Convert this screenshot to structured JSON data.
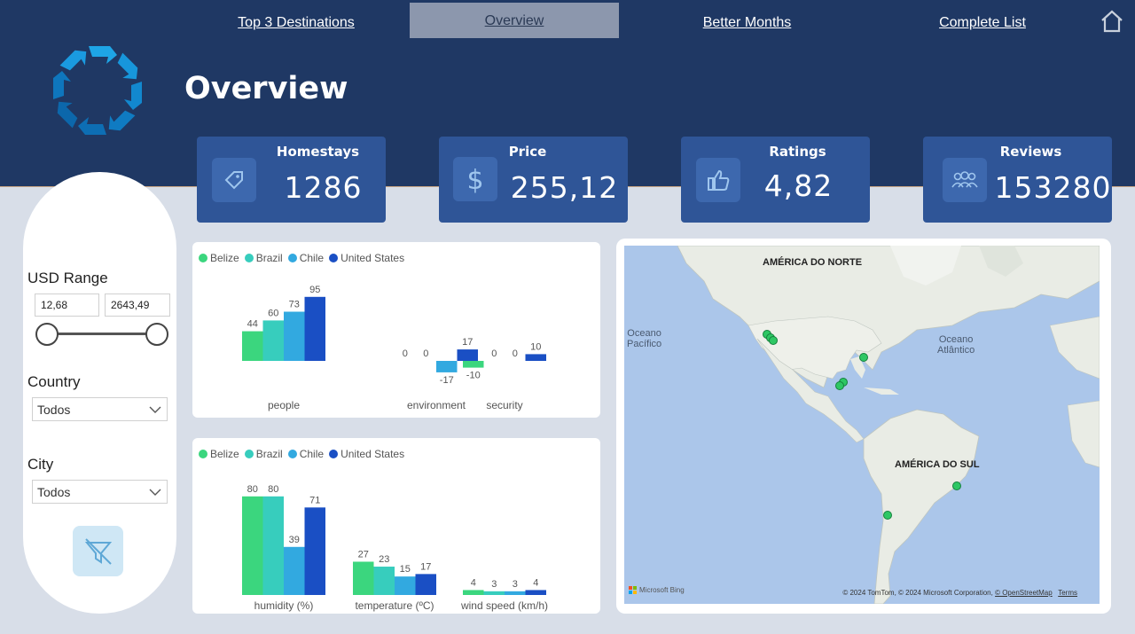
{
  "nav": {
    "items": [
      "Top 3 Destinations",
      "Overview",
      "Better Months",
      "Complete List"
    ],
    "active": "Overview"
  },
  "page": {
    "title": "Overview"
  },
  "kpis": [
    {
      "label": "Homestays",
      "value": "1286",
      "icon": "tag-icon"
    },
    {
      "label": "Price",
      "value": "255,12",
      "icon": "dollar-icon"
    },
    {
      "label": "Ratings",
      "value": "4,82",
      "icon": "thumbs-up-icon"
    },
    {
      "label": "Reviews",
      "value": "153280",
      "icon": "people-icon"
    }
  ],
  "filters": {
    "usd_range_label": "USD Range",
    "usd_min": "12,68",
    "usd_max": "2643,49",
    "country_label": "Country",
    "country_value": "Todos",
    "city_label": "City",
    "city_value": "Todos"
  },
  "colors": {
    "Belize": "#3bd67e",
    "Brazil": "#37cdbd",
    "Chile": "#32a9e0",
    "United States": "#1a4fc4",
    "header": "#1f3864",
    "kpi": "#2f5597"
  },
  "chart_data": [
    {
      "type": "bar",
      "categories": [
        "people",
        "environment",
        "security"
      ],
      "series": [
        {
          "name": "Belize",
          "values": [
            44,
            0,
            -10
          ]
        },
        {
          "name": "Brazil",
          "values": [
            60,
            0,
            0
          ]
        },
        {
          "name": "Chile",
          "values": [
            73,
            -17,
            0
          ]
        },
        {
          "name": "United States",
          "values": [
            95,
            17,
            10
          ]
        }
      ],
      "legend": "top-left",
      "grid": false
    },
    {
      "type": "bar",
      "categories": [
        "humidity (%)",
        "temperature (ºC)",
        "wind speed (km/h)"
      ],
      "series": [
        {
          "name": "Belize",
          "values": [
            80,
            27,
            4
          ]
        },
        {
          "name": "Brazil",
          "values": [
            80,
            23,
            3
          ]
        },
        {
          "name": "Chile",
          "values": [
            39,
            15,
            3
          ]
        },
        {
          "name": "United States",
          "values": [
            71,
            17,
            4
          ]
        }
      ],
      "legend": "top-left",
      "grid": false
    }
  ],
  "map": {
    "labels": {
      "north_america": "AMÉRICA DO NORTE",
      "south_america": "AMÉRICA DO SUL",
      "pacific_1": "Oceano",
      "pacific_2": "Pacífico",
      "atlantic_1": "Oceano",
      "atlantic_2": "Atlântico"
    },
    "provider": "Microsoft Bing",
    "attribution": "© 2024 TomTom, © 2024 Microsoft Corporation,",
    "osm_link": "© OpenStreetMap",
    "terms_link": "Terms"
  }
}
